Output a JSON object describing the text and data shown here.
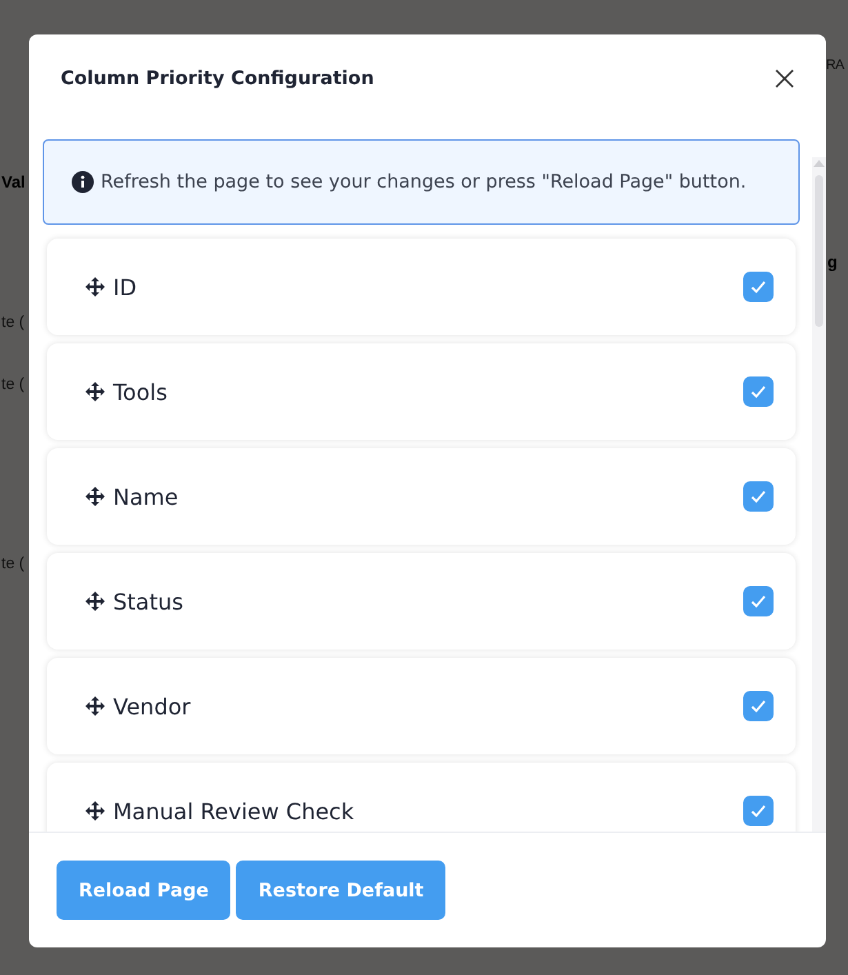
{
  "background": {
    "fragments": [
      {
        "text": "Val",
        "kind": "heading"
      },
      {
        "text": "te (",
        "kind": "cell"
      },
      {
        "text": "te (",
        "kind": "cell"
      },
      {
        "text": "te (",
        "kind": "cell"
      },
      {
        "text": "RA",
        "kind": "cell"
      },
      {
        "text": "g",
        "kind": "heading"
      }
    ]
  },
  "dialog": {
    "title": "Column Priority Configuration",
    "notice": "Refresh the page to see your changes or press \"Reload Page\" button.",
    "columns": [
      {
        "label": "ID",
        "checked": true
      },
      {
        "label": "Tools",
        "checked": true
      },
      {
        "label": "Name",
        "checked": true
      },
      {
        "label": "Status",
        "checked": true
      },
      {
        "label": "Vendor",
        "checked": true
      },
      {
        "label": "Manual Review Check",
        "checked": true
      }
    ],
    "buttons": [
      "Reload Page",
      "Restore Default"
    ]
  }
}
